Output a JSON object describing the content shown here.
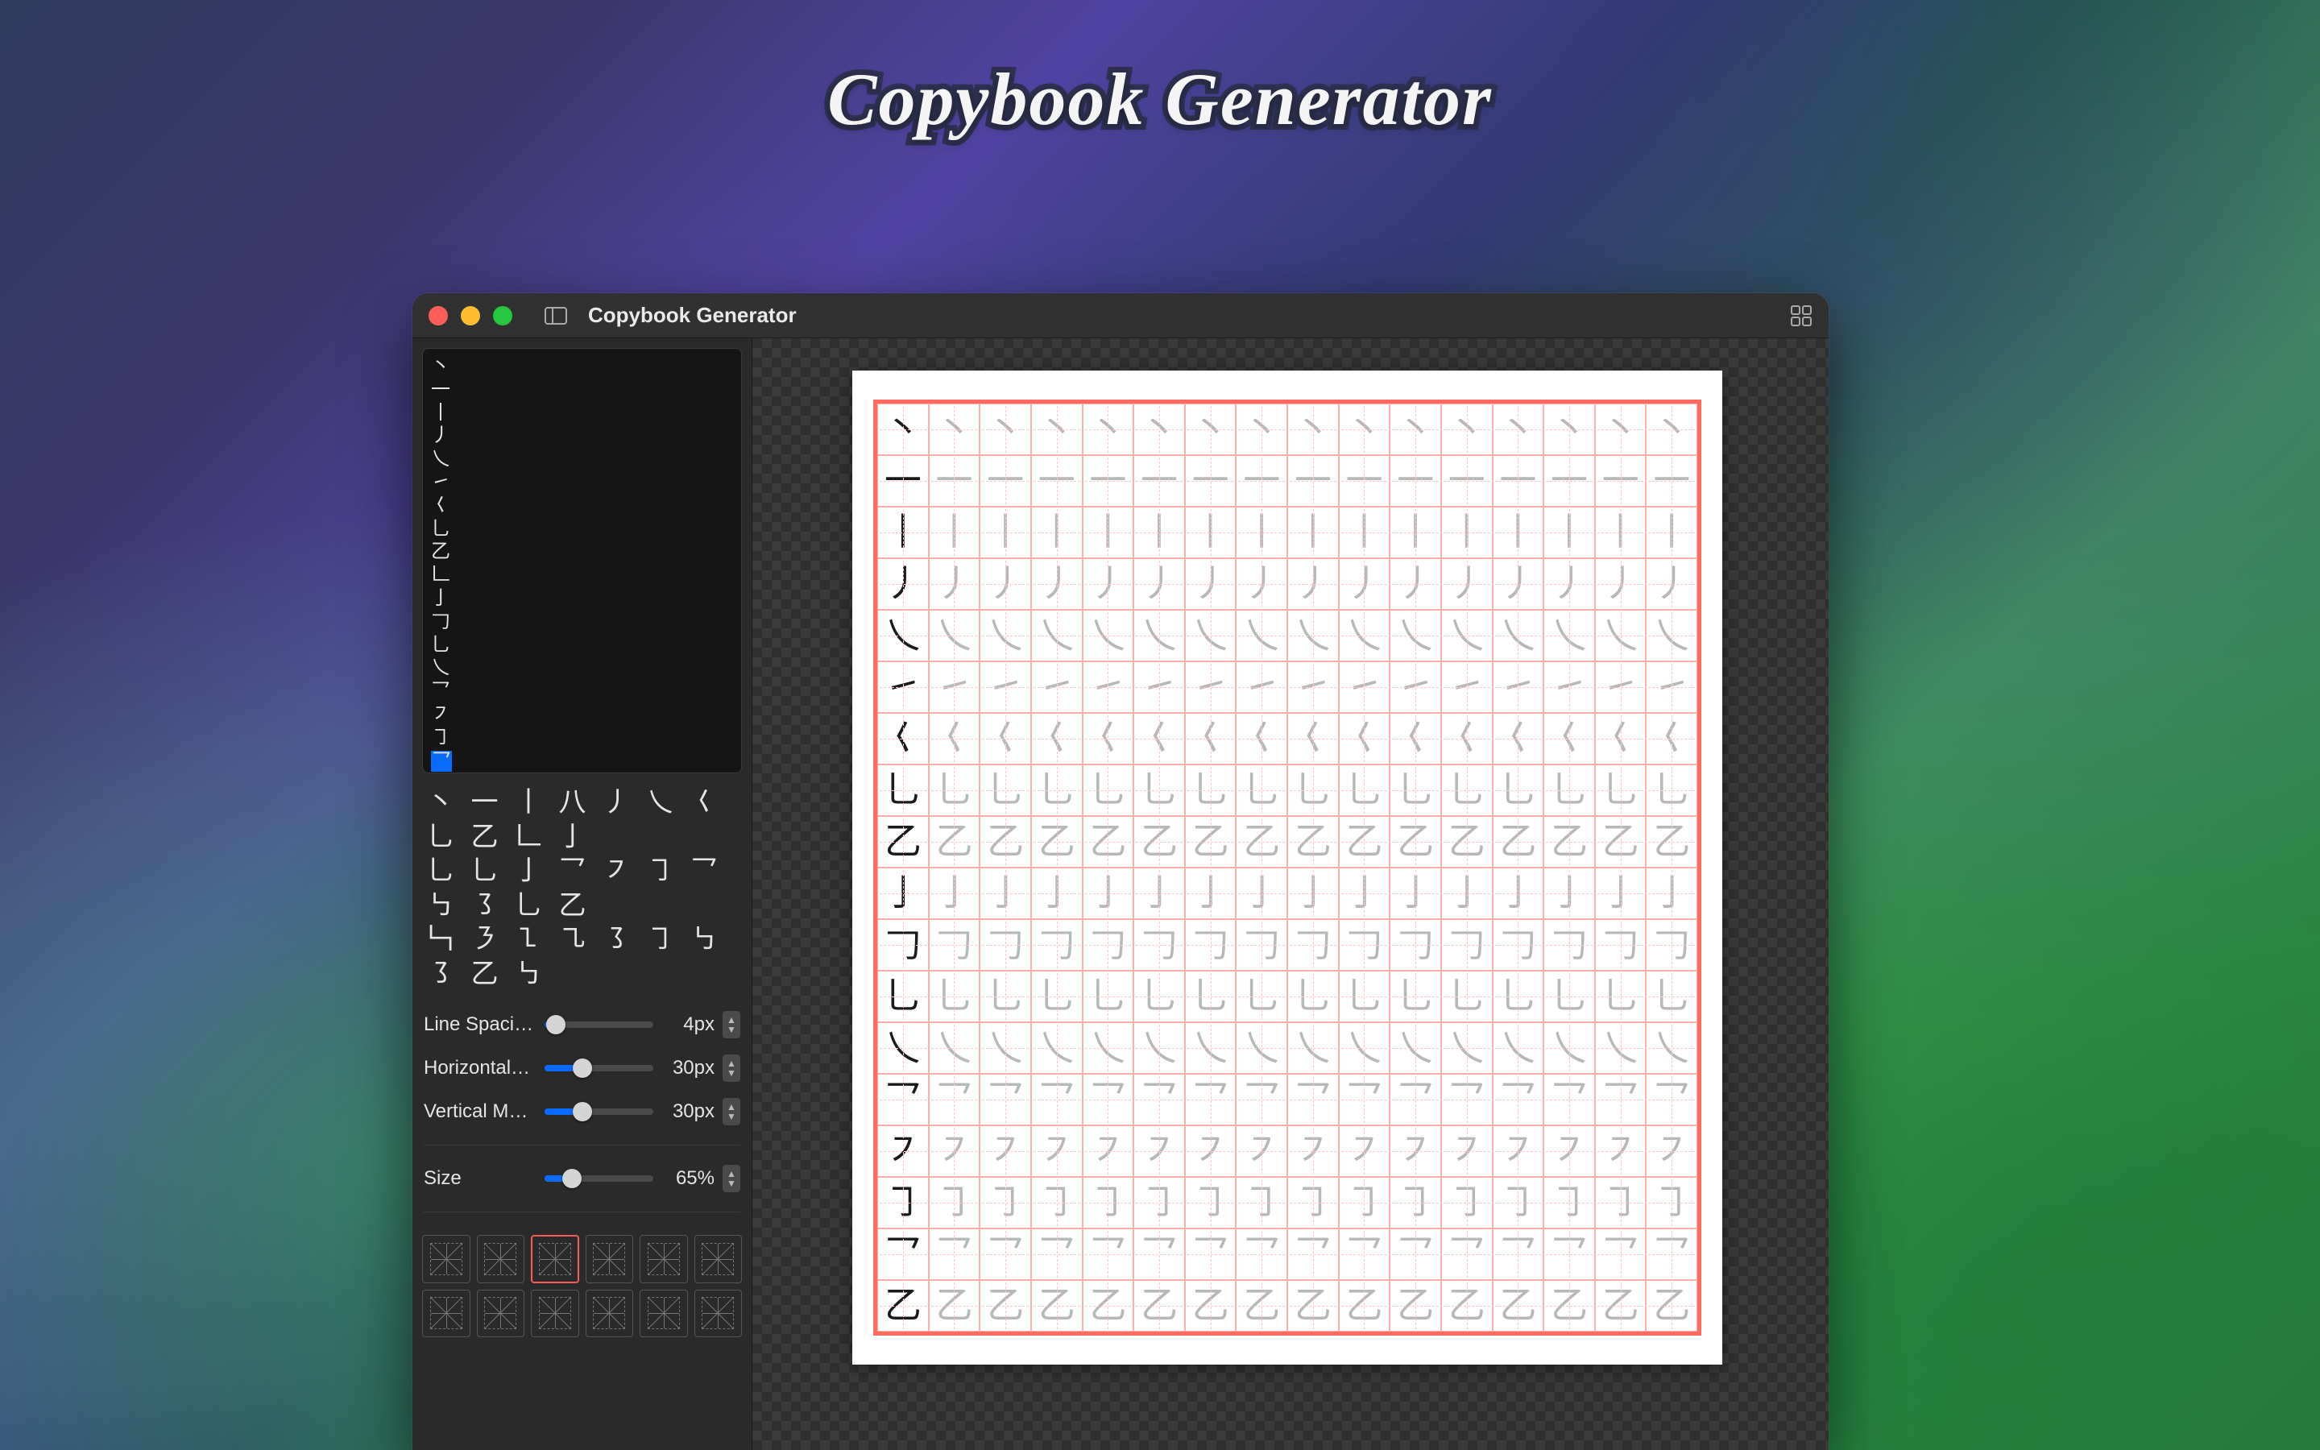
{
  "hero_title": "Copybook Generator",
  "window": {
    "title": "Copybook Generator"
  },
  "editor": {
    "lines": [
      "丶",
      "一",
      "丨",
      "丿",
      "乀",
      "㇀",
      "𡿨",
      "乚",
      "乙",
      "𠃊",
      "亅",
      "𠃌",
      "乚",
      "乀",
      "乛",
      "㇇",
      "㇆",
      "乛"
    ]
  },
  "palette": {
    "rows": [
      "丶 一 丨 八 丿 乀 𡿨 乚 乙 𠃊 亅",
      "乚 乚 亅 乛 ㇇ ㇆ 乛 ㇉ ㇌ 乚 乙",
      "𠃑 ㇋ ㇅ ㇈ ㇌ ㇆ ㇉ ㇌ 乙 ㇉"
    ]
  },
  "controls": {
    "line_spacing": {
      "label": "Line Spaci…",
      "value": "4px",
      "percent": 10
    },
    "horizontal": {
      "label": "Horizontal…",
      "value": "30px",
      "percent": 35
    },
    "vertical": {
      "label": "Vertical M…",
      "value": "30px",
      "percent": 35
    },
    "size": {
      "label": "Size",
      "value": "65%",
      "percent": 25
    }
  },
  "presets": {
    "selected_index": 2,
    "count": 12
  },
  "worksheet": {
    "columns": 16,
    "rows": [
      "丶",
      "一",
      "丨",
      "丿",
      "乀",
      "㇀",
      "𡿨",
      "乚",
      "乙",
      "亅",
      "𠃌",
      "乚",
      "乀",
      "乛",
      "㇇",
      "㇆",
      "乛",
      "乙"
    ],
    "trace_mode": "after_first"
  }
}
